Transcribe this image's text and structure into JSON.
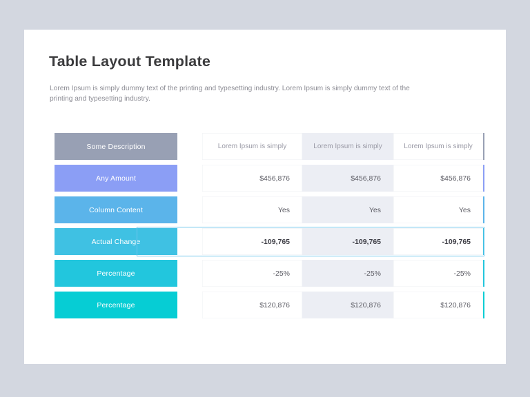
{
  "slide": {
    "title": "Table Layout Template",
    "subtitle": "Lorem Ipsum is simply dummy text of the printing and typesetting industry. Lorem Ipsum is simply dummy text of the printing and typesetting industry."
  },
  "colors": {
    "page_background": "#d3d7e0",
    "card_background": "#ffffff",
    "title": "#3b3b3d",
    "subtitle": "#8d8d95",
    "shaded_column": "#eceef4",
    "highlight_outline": "#6fc6ec",
    "row_colors": [
      "#98a0b4",
      "#8b9ef5",
      "#5bb4ea",
      "#3fc1e3",
      "#22c6dd",
      "#06cdd4"
    ]
  },
  "table": {
    "columns": [
      {
        "key": "c1",
        "header": "Lorem Ipsum is simply",
        "shaded": false
      },
      {
        "key": "c2",
        "header": "Lorem Ipsum is simply",
        "shaded": true
      },
      {
        "key": "c3",
        "header": "Lorem Ipsum is simply",
        "shaded": false
      }
    ],
    "rows": [
      {
        "label": "Some Description",
        "color": "#98a0b4",
        "type": "header",
        "emphasis": false,
        "values": [
          "Lorem Ipsum is simply",
          "Lorem Ipsum is simply",
          "Lorem Ipsum is simply"
        ]
      },
      {
        "label": "Any Amount",
        "color": "#8b9ef5",
        "type": "data",
        "emphasis": false,
        "values": [
          "$456,876",
          "$456,876",
          "$456,876"
        ]
      },
      {
        "label": "Column Content",
        "color": "#5bb4ea",
        "type": "data",
        "emphasis": false,
        "values": [
          "Yes",
          "Yes",
          "Yes"
        ]
      },
      {
        "label": "Actual Change",
        "color": "#3fc1e3",
        "type": "data",
        "emphasis": true,
        "values": [
          "-109,765",
          "-109,765",
          "-109,765"
        ]
      },
      {
        "label": "Percentage",
        "color": "#22c6dd",
        "type": "data",
        "emphasis": false,
        "values": [
          "-25%",
          "-25%",
          "-25%"
        ]
      },
      {
        "label": "Percentage",
        "color": "#06cdd4",
        "type": "data",
        "emphasis": false,
        "values": [
          "$120,876",
          "$120,876",
          "$120,876"
        ]
      }
    ]
  }
}
